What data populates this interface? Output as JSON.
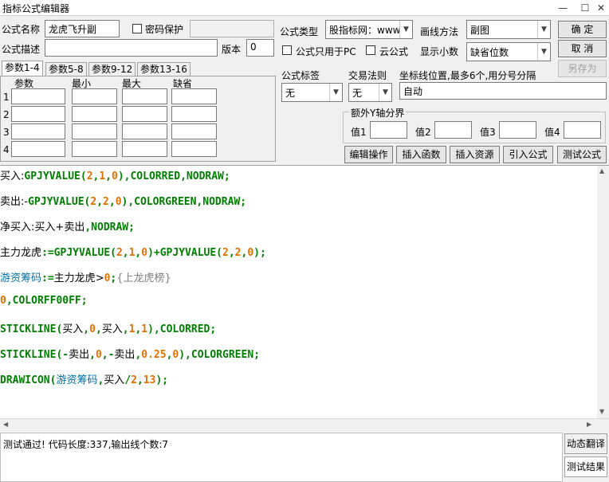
{
  "window": {
    "title": "指标公式编辑器",
    "minimize": "—",
    "maximize": "☐",
    "close": "✕"
  },
  "form": {
    "name_label": "公式名称",
    "name_value": "龙虎飞升副",
    "password_label": "密码保护",
    "desc_label": "公式描述",
    "version_label": "版本",
    "version_value": "0",
    "type_label": "公式类型",
    "type_value": "股指标网：www",
    "pc_only_label": "公式只用于PC",
    "cloud_label": "云公式",
    "draw_label": "画线方法",
    "draw_value": "副图",
    "decimals_label": "显示小数",
    "decimals_value": "缺省位数",
    "ok": "确  定",
    "cancel": "取  消",
    "saveas": "另存为",
    "formula_tag_label": "公式标签",
    "formula_tag_value": "无",
    "trade_rule_label": "交易法则",
    "trade_rule_value": "无",
    "axis_label": "坐标线位置,最多6个,用分号分隔",
    "axis_value": "自动",
    "yaxis_group": "额外Y轴分界",
    "yaxis": [
      "值1",
      "值2",
      "值3",
      "值4"
    ]
  },
  "params": {
    "tabs": [
      "参数1-4",
      "参数5-8",
      "参数9-12",
      "参数13-16"
    ],
    "headers": [
      "参数",
      "最小",
      "最大",
      "缺省"
    ],
    "rows": [
      "1",
      "2",
      "3",
      "4"
    ]
  },
  "toolbar": [
    "编辑操作",
    "插入函数",
    "插入资源",
    "引入公式",
    "测试公式"
  ],
  "code": {
    "l1": [
      "买入",
      ":",
      "GPJYVALUE(",
      "2",
      ",",
      "1",
      ",",
      "0",
      "),COLORRED,NODRAW;"
    ],
    "l2": [
      "卖出",
      ":-",
      "GPJYVALUE(",
      "2",
      ",",
      "2",
      ",",
      "0",
      "),COLORGREEN,NODRAW;"
    ],
    "l3": [
      "净买入",
      ":",
      "买入",
      "+",
      "卖出",
      ",NODRAW;"
    ],
    "l4": [
      "主力龙虎",
      ":=GPJYVALUE(",
      "2",
      ",",
      "1",
      ",",
      "0",
      ")+GPJYVALUE(",
      "2",
      ",",
      "2",
      ",",
      "0",
      ");"
    ],
    "l5": [
      "游资筹码",
      ":=",
      "主力龙虎",
      ">",
      "0",
      ";",
      "{上龙虎榜}"
    ],
    "l6": [
      "0",
      ",COLORFF00FF;"
    ],
    "l7": [
      "STICKLINE(",
      "买入",
      ",",
      "0",
      ",",
      "买入",
      ",",
      "1",
      ",",
      "1",
      "),COLORRED;"
    ],
    "l8": [
      "STICKLINE(-",
      "卖出",
      ",",
      "0",
      ",-",
      "卖出",
      ",",
      "0.25",
      ",",
      "0",
      "),COLORGREEN;"
    ],
    "l9": [
      "DRAWICON(",
      "游资筹码",
      ",",
      "买入",
      "/",
      "2",
      ",",
      "13",
      ");"
    ]
  },
  "status": {
    "text": "测试通过! 代码长度:337,输出线个数:7",
    "translate": "动态翻译",
    "result": "测试结果"
  }
}
